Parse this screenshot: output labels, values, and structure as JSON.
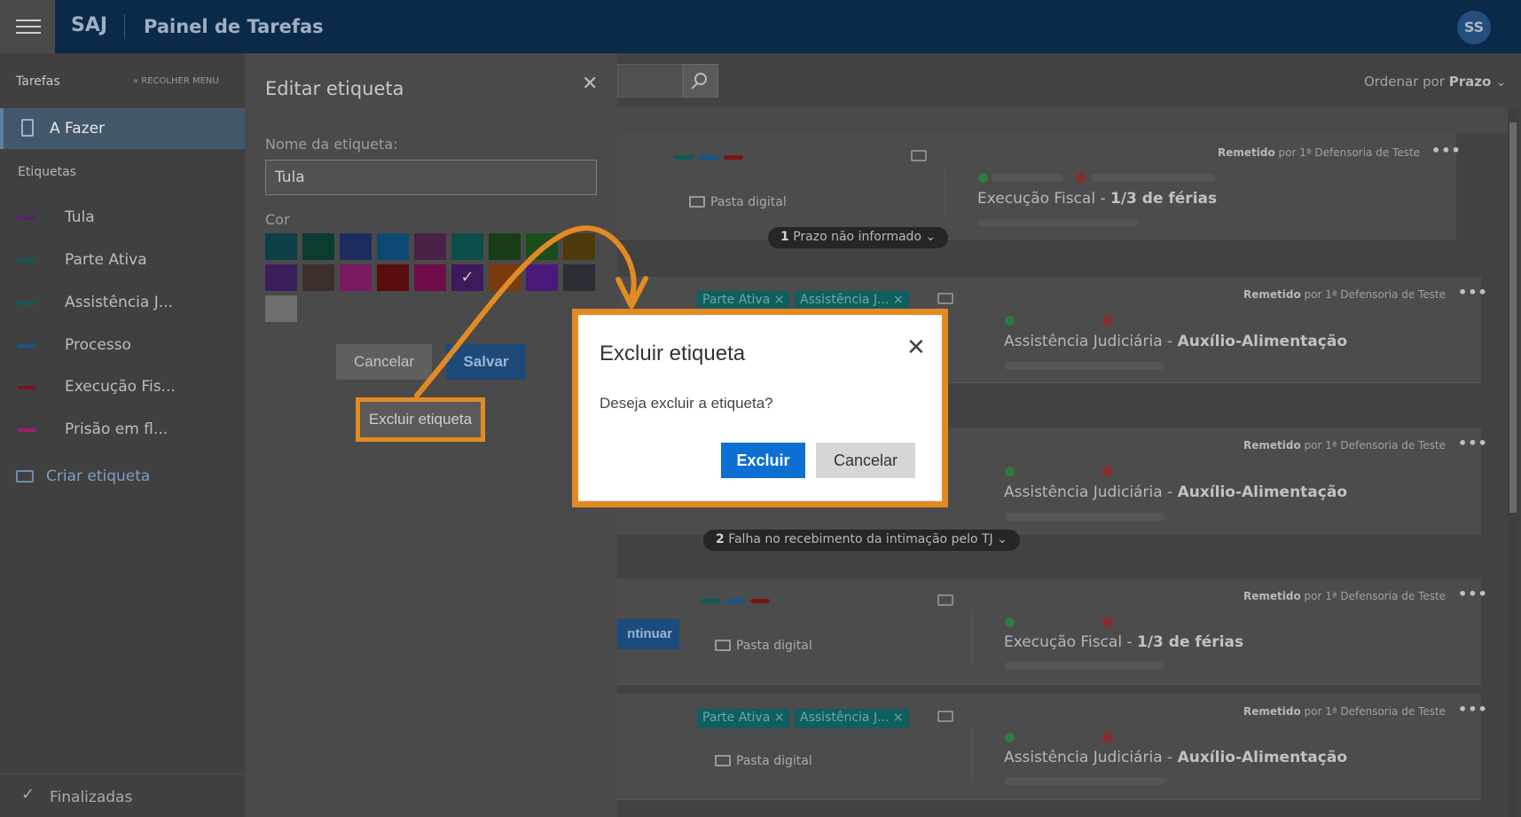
{
  "topbar": {
    "brand": "SAJ",
    "title": "Painel de Tarefas",
    "avatar": "SS"
  },
  "sidebar": {
    "header": "Tarefas",
    "collapse": "« RECOLHER MENU",
    "active": "A Fazer",
    "labels_heading": "Etiquetas",
    "items": [
      {
        "label": "Tula",
        "color": "#5b1f74"
      },
      {
        "label": "Parte Ativa",
        "color": "#0d5b5b"
      },
      {
        "label": "Assistência J...",
        "color": "#0d5b5b"
      },
      {
        "label": "Processo",
        "color": "#14568a"
      },
      {
        "label": "Execução Fis...",
        "color": "#7a1515"
      },
      {
        "label": "Prisão em fl...",
        "color": "#9a1d76"
      }
    ],
    "create": "Criar etiqueta",
    "finished": "Finalizadas"
  },
  "edit": {
    "title": "Editar etiqueta",
    "name_label": "Nome da etiqueta:",
    "name_value": "Tula",
    "color_label": "Cor",
    "swatches": [
      "#0d3f47",
      "#0c3b32",
      "#1c2c5e",
      "#0d4a73",
      "#4a2148",
      "#0d4d4a",
      "#183d17",
      "#1c4d1d",
      "#4f3a0c",
      "#3a1f5c",
      "#3b302b",
      "#7a1a62",
      "#5a0d0d",
      "#6e0d4a",
      "#3d1a5a",
      "#7a3a0d",
      "#4a1a7a",
      "#2b2f35",
      "#6e6e6e"
    ],
    "cancel": "Cancelar",
    "save": "Salvar",
    "delete": "Excluir etiqueta"
  },
  "main": {
    "order_label": "Ordenar por",
    "order_value": "Prazo",
    "folder": "Pasta digital",
    "continue": "ntinuar",
    "sent_prefix": "Remetido",
    "sent_suffix": "por 1ª Defensoria de Teste",
    "tag_parte": "Parte Ativa ×",
    "tag_assist": "Assistência J... ×",
    "pill1_num": "1",
    "pill1_txt": "Prazo não informado",
    "pill2_num": "2",
    "pill2_txt": "Falha no recebimento da intimação pelo TJ",
    "subject_fiscal_a": "Execução Fiscal - ",
    "subject_fiscal_b": "1/3 de férias",
    "subject_assist_a": "Assistência Judiciária - ",
    "subject_assist_b": "Auxílio-Alimentação"
  },
  "modal": {
    "title": "Excluir etiqueta",
    "message": "Deseja excluir a etiqueta?",
    "confirm": "Excluir",
    "cancel": "Cancelar"
  },
  "colors": {
    "accent": "#0c6fd1",
    "highlight": "#e38a22"
  }
}
